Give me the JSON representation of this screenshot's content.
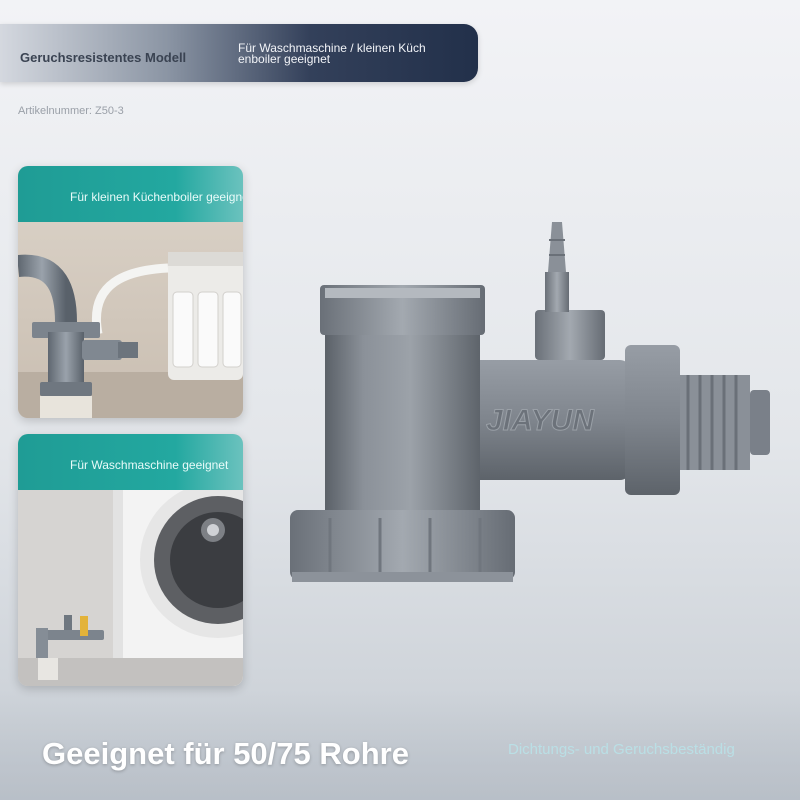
{
  "banner": {
    "model_label": "Geruchsresistentes Modell",
    "suitability_line1": "Für Waschmaschine / kleinen Küch",
    "suitability_line2": "enboiler geeignet"
  },
  "article_number": "Artikelnummer: Z50-3",
  "cards": [
    {
      "title": "Für kleinen Küchenboiler geeignet"
    },
    {
      "title": "Für Waschmaschine geeignet"
    }
  ],
  "product": {
    "brand": "JIAYUN"
  },
  "footer": {
    "headline": "Geeignet für 50/75 Rohre",
    "tagline": "Dichtungs- und Geruchsbeständig"
  },
  "colors": {
    "accent_teal": "#23a8a0",
    "banner_dark": "#22304a",
    "pvc_gray": "#7a8089"
  }
}
